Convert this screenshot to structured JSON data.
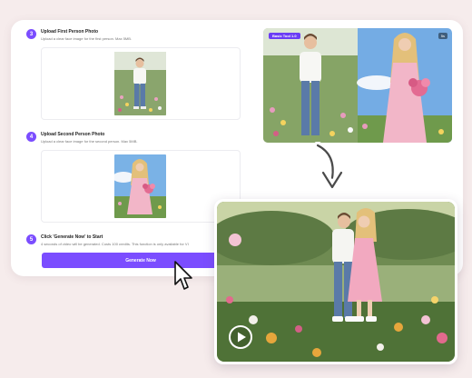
{
  "steps": [
    {
      "num": "3",
      "title": "Upload First Person Photo",
      "desc": "Upload a clear face image for the first person. Max 5MB."
    },
    {
      "num": "4",
      "title": "Upload Second Person Photo",
      "desc": "Upload a clear face image for the second person. Max 5MB."
    },
    {
      "num": "5",
      "title": "Click 'Generate Now' to Start",
      "desc": "4 seconds of video will be generated. Costs 100 credits. This function is only available for VI"
    }
  ],
  "generate_button": "Generate Now",
  "preview": {
    "badge": "Basic Tool 1.0",
    "count": "5s"
  },
  "icons": {
    "arrow": "curved-arrow-down-icon",
    "play": "play-icon",
    "cursor": "cursor-pointer-icon"
  },
  "colors": {
    "accent": "#7b4dff",
    "background": "#f6ecec"
  }
}
